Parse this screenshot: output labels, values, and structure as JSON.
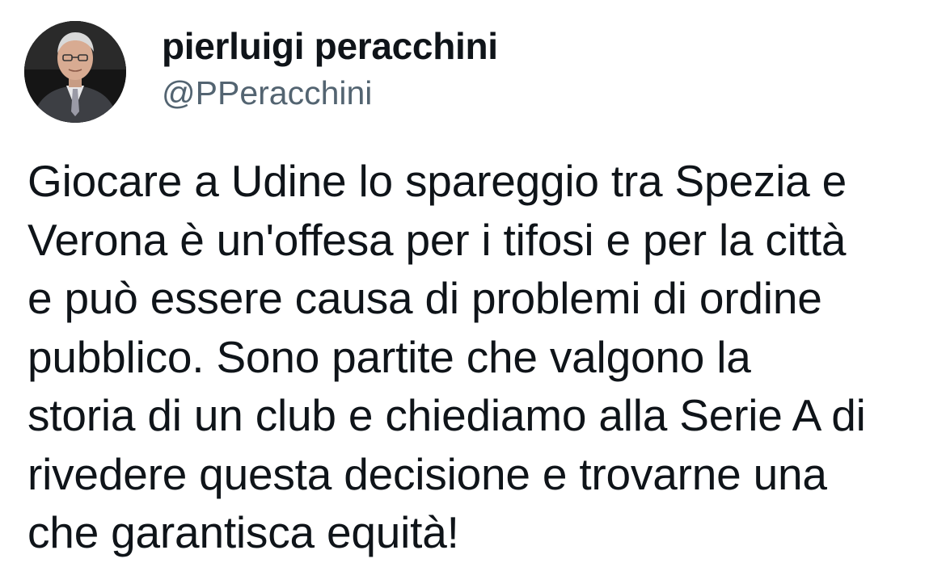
{
  "author": {
    "display_name": "pierluigi peracchini",
    "handle": "@PPeracchini",
    "avatar_icon": "profile-photo"
  },
  "tweet": {
    "lines": [
      "Giocare a Udine lo spareggio tra Spezia e",
      "Verona è un'offesa per i tifosi e per la città",
      "e può essere causa di problemi di ordine",
      "pubblico. Sono partite che valgono la",
      "storia di un club e chiediamo alla Serie A di",
      "rivedere questa decisione e trovarne una",
      "che garantisca equità!"
    ]
  },
  "colors": {
    "text": "#0f1419",
    "handle": "#536471",
    "background": "#ffffff"
  }
}
